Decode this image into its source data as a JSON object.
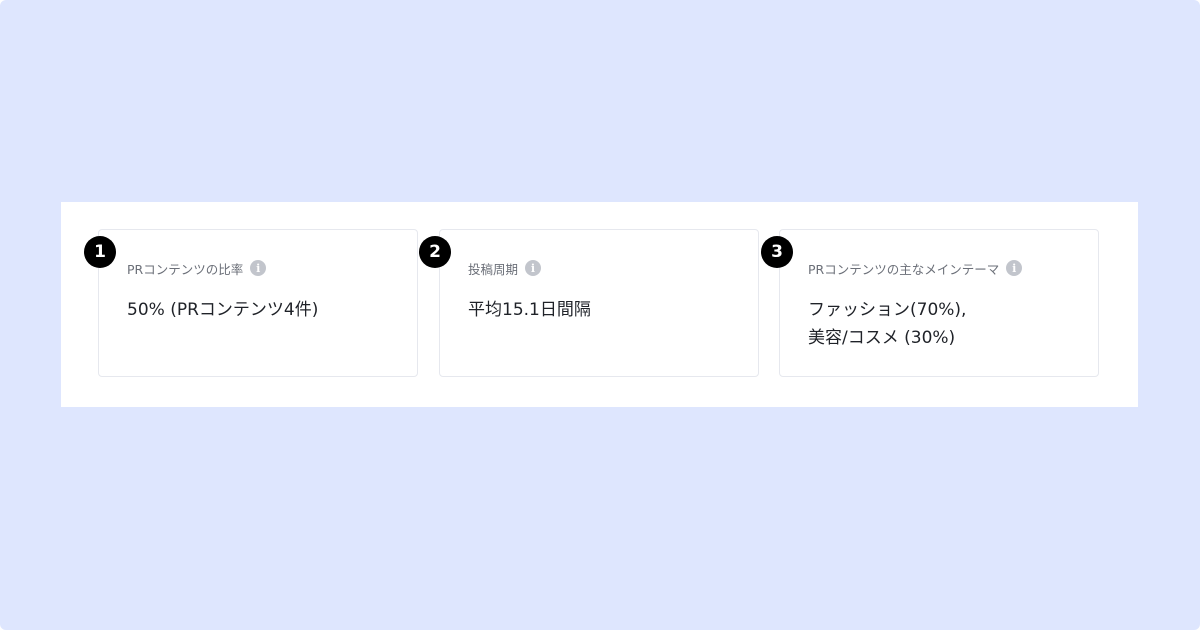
{
  "cards": [
    {
      "number": "1",
      "label": "PRコンテンツの比率",
      "info_icon": "i",
      "value_lines": [
        "50% (PRコンテンツ4件)"
      ]
    },
    {
      "number": "2",
      "label": "投稿周期",
      "info_icon": "i",
      "value_lines": [
        "平均15.1日間隔"
      ]
    },
    {
      "number": "3",
      "label": "PRコンテンツの主なメインテーマ",
      "info_icon": "i",
      "value_lines": [
        "ファッション(70%),",
        "美容/コスメ (30%)"
      ]
    }
  ],
  "colors": {
    "background": "#dee6fe",
    "panel": "#ffffff",
    "badge": "#000000",
    "info_icon": "#c2c5cc",
    "label_text": "#6b6f78",
    "value_text": "#1f2228"
  }
}
